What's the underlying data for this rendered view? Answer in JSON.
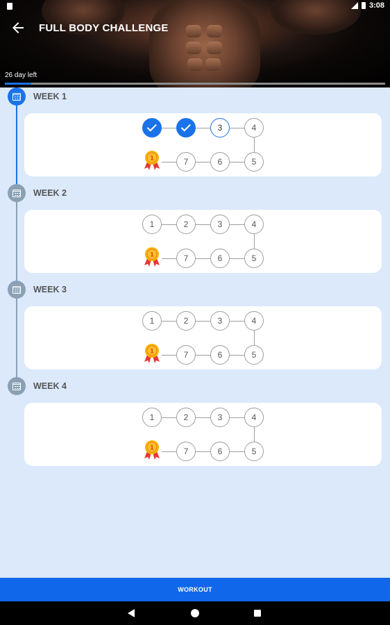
{
  "status_bar": {
    "time": "3:08"
  },
  "header": {
    "title": "FULL BODY CHALLENGE",
    "days_left": "26 day left",
    "progress_fraction": 0.07
  },
  "weeks": [
    {
      "label": "WEEK 1",
      "top_row": [
        {
          "n": "1",
          "state": "done"
        },
        {
          "n": "2",
          "state": "done"
        },
        {
          "n": "3",
          "state": "current"
        },
        {
          "n": "4",
          "state": "todo"
        }
      ],
      "bottom_row": [
        {
          "n": "7",
          "state": "todo"
        },
        {
          "n": "6",
          "state": "todo"
        },
        {
          "n": "5",
          "state": "todo"
        }
      ]
    },
    {
      "label": "WEEK 2",
      "top_row": [
        {
          "n": "1",
          "state": "todo"
        },
        {
          "n": "2",
          "state": "todo"
        },
        {
          "n": "3",
          "state": "todo"
        },
        {
          "n": "4",
          "state": "todo"
        }
      ],
      "bottom_row": [
        {
          "n": "7",
          "state": "todo"
        },
        {
          "n": "6",
          "state": "todo"
        },
        {
          "n": "5",
          "state": "todo"
        }
      ]
    },
    {
      "label": "WEEK 3",
      "top_row": [
        {
          "n": "1",
          "state": "todo"
        },
        {
          "n": "2",
          "state": "todo"
        },
        {
          "n": "3",
          "state": "todo"
        },
        {
          "n": "4",
          "state": "todo"
        }
      ],
      "bottom_row": [
        {
          "n": "7",
          "state": "todo"
        },
        {
          "n": "6",
          "state": "todo"
        },
        {
          "n": "5",
          "state": "todo"
        }
      ]
    },
    {
      "label": "WEEK 4",
      "top_row": [
        {
          "n": "1",
          "state": "todo"
        },
        {
          "n": "2",
          "state": "todo"
        },
        {
          "n": "3",
          "state": "todo"
        },
        {
          "n": "4",
          "state": "todo"
        }
      ],
      "bottom_row": [
        {
          "n": "7",
          "state": "todo"
        },
        {
          "n": "6",
          "state": "todo"
        },
        {
          "n": "5",
          "state": "todo"
        }
      ]
    }
  ],
  "workout_button": {
    "label": "WORKOUT"
  },
  "colors": {
    "accent": "#1a73e8",
    "button": "#1167ea",
    "background": "#dbe9fb"
  }
}
